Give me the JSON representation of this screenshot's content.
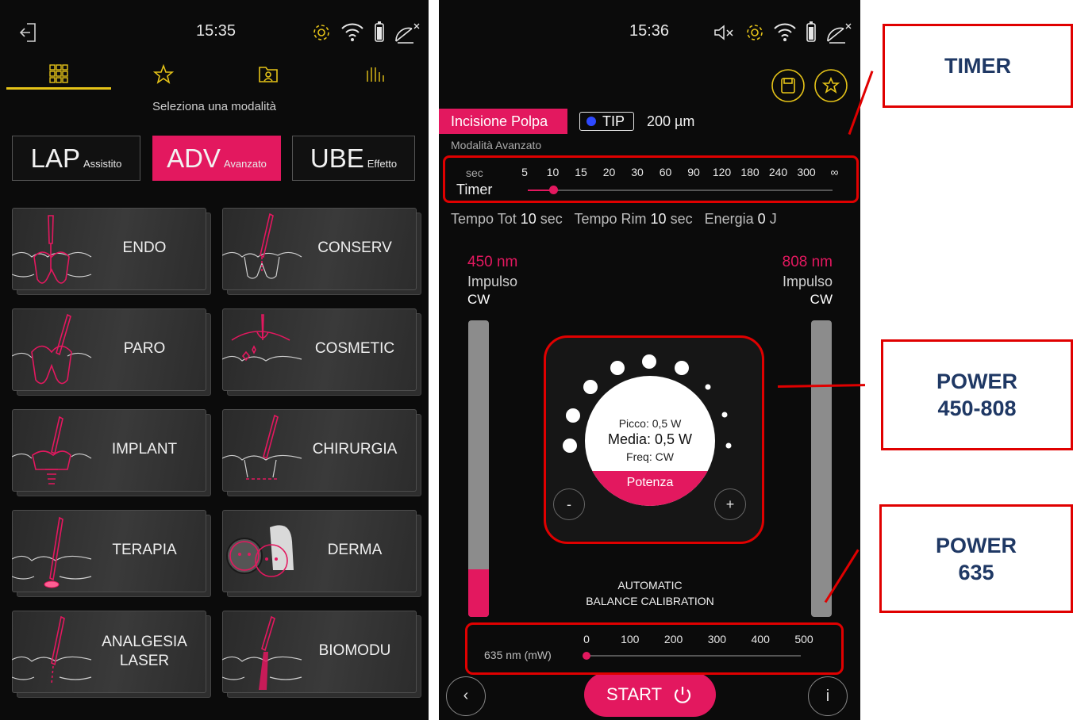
{
  "left": {
    "status": {
      "time": "15:35"
    },
    "subtitle": "Seleziona una modalità",
    "modes": [
      {
        "big": "LAP",
        "small": "Assistito"
      },
      {
        "big": "ADV",
        "small": "Avanzato"
      },
      {
        "big": "UBE",
        "small": "Effetto"
      }
    ],
    "cards": [
      "ENDO",
      "CONSERV",
      "PARO",
      "COSMETIC",
      "IMPLANT",
      "CHIRURGIA",
      "TERAPIA",
      "DERMA",
      "ANALGESIA\nLASER",
      "BIOMODU"
    ]
  },
  "right": {
    "status": {
      "time": "15:36"
    },
    "mode_tag": "Incisione Polpa",
    "tip_label": "TIP",
    "tip_size": "200 µm",
    "mode_sub": "Modalità Avanzato",
    "timer": {
      "unit": "sec",
      "label": "Timer",
      "values": [
        "5",
        "10",
        "15",
        "20",
        "30",
        "60",
        "90",
        "120",
        "180",
        "240",
        "300",
        "∞"
      ],
      "selected": "10"
    },
    "info": {
      "tot_label": "Tempo Tot",
      "tot_value": "10",
      "tot_unit": "sec",
      "rim_label": "Tempo Rim",
      "rim_value": "10",
      "rim_unit": "sec",
      "en_label": "Energia",
      "en_value": "0",
      "en_unit": "J"
    },
    "laser_left": {
      "wavelength": "450 nm",
      "mode": "Impulso",
      "wave": "CW",
      "level": 0.16
    },
    "laser_right": {
      "wavelength": "808 nm",
      "mode": "Impulso",
      "wave": "CW",
      "level": 0.0
    },
    "power": {
      "peak": "Picco: 0,5 W",
      "avg": "Media: 0,5 W",
      "freq": "Freq: CW",
      "label": "Potenza",
      "minus": "-",
      "plus": "+"
    },
    "calibration": "AUTOMATIC\nBALANCE CALIBRATION",
    "p635": {
      "label": "635 nm (mW)",
      "values": [
        "0",
        "100",
        "200",
        "300",
        "400",
        "500"
      ],
      "selected": "0"
    },
    "start": "START",
    "back": "‹",
    "info_btn": "i"
  },
  "callouts": {
    "timer": "TIMER",
    "power_main": "POWER\n450-808",
    "power_635": "POWER\n635"
  },
  "colors": {
    "accent": "#e3185f",
    "icon_yellow": "#e5c318",
    "annotation": "#e00000",
    "callout_text": "#1f3864"
  }
}
